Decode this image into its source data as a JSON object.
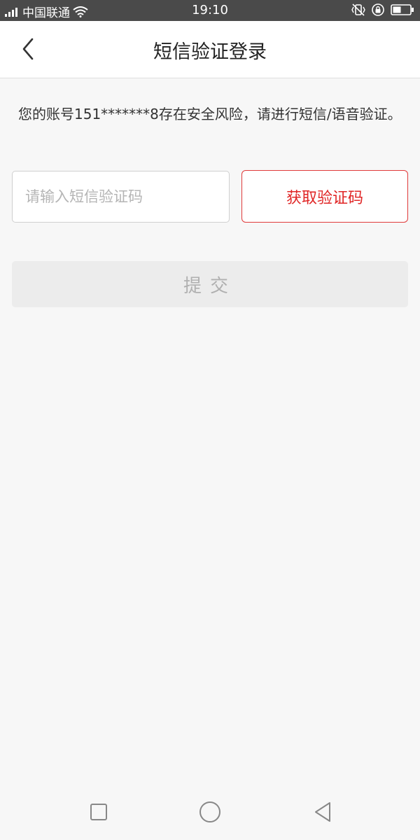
{
  "status_bar": {
    "carrier": "中国联通",
    "time": "19:10",
    "icons": [
      "signal-icon",
      "wifi-icon",
      "vibrate-icon",
      "rotation-lock-icon",
      "battery-icon"
    ]
  },
  "header": {
    "title": "短信验证登录",
    "back_icon": "chevron-left-icon"
  },
  "notice": {
    "text": "您的账号151*******8存在安全风险，请进行短信/语音验证。"
  },
  "code_input": {
    "value": "",
    "placeholder": "请输入短信验证码"
  },
  "get_code_button": {
    "label": "获取验证码",
    "color": "#e02626"
  },
  "submit_button": {
    "label": "提交",
    "enabled": false
  },
  "nav_bar": {
    "icons": [
      "square-icon",
      "circle-icon",
      "triangle-back-icon"
    ]
  }
}
